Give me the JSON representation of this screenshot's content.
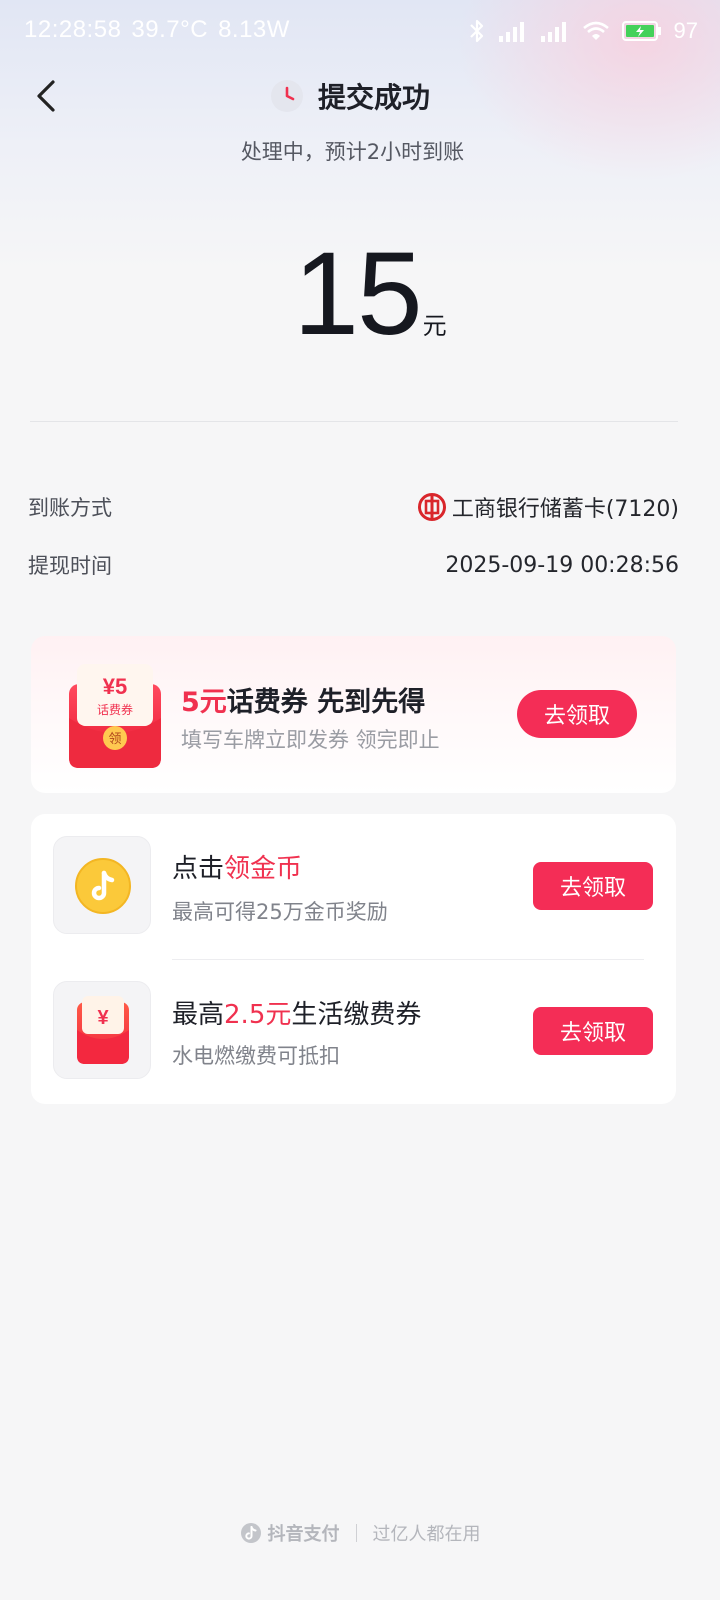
{
  "status_bar": {
    "time": "12:28:58",
    "temperature": "39.7°C",
    "power": "8.13W",
    "battery": "97"
  },
  "header": {
    "title": "提交成功",
    "subtitle": "处理中，预计2小时到账"
  },
  "amount": {
    "value": "15",
    "unit": "元"
  },
  "details": {
    "method_label": "到账方式",
    "method_value": "工商银行储蓄卡(7120)",
    "time_label": "提现时间",
    "time_value": "2025-09-19 00:28:56"
  },
  "promo": {
    "packet_amount": "¥5",
    "packet_label": "话费券",
    "packet_seal": "领",
    "title_highlight": "5元",
    "title_rest": "话费券 先到先得",
    "subtitle": "填写车牌立即发券 领完即止",
    "button": "去领取"
  },
  "offers": [
    {
      "title_prefix": "点击",
      "title_highlight": "领金币",
      "title_suffix": "",
      "subtitle": "最高可得25万金币奖励",
      "button": "去领取",
      "icon": "coin-icon"
    },
    {
      "title_prefix": "最高",
      "title_highlight": "2.5元",
      "title_suffix": "生活缴费券",
      "subtitle": "水电燃缴费可抵扣",
      "button": "去领取",
      "icon": "red-envelope-icon"
    }
  ],
  "footer": {
    "brand": "抖音支付",
    "slogan": "过亿人都在用"
  },
  "colors": {
    "accent": "#f42d56",
    "highlight": "#f0314f",
    "coin": "#fbc93a"
  }
}
